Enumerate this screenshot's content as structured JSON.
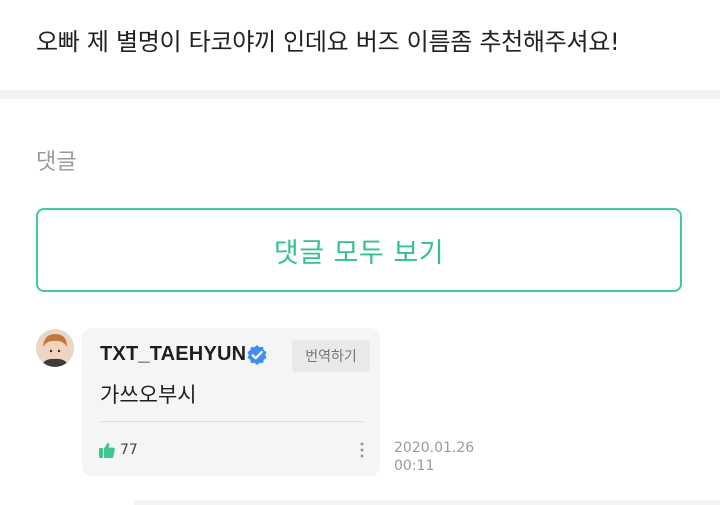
{
  "post": {
    "text": "오빠 제 별명이 타코야끼 인데요 버즈 이름좀 추천해주셔요!"
  },
  "comments": {
    "heading": "댓글",
    "view_all_label": "댓글 모두 보기",
    "items": [
      {
        "username": "TXT_TAEHYUN",
        "verified": true,
        "translate_label": "번역하기",
        "text": "가쓰오부시",
        "like_count": "77",
        "date": "2020.01.26",
        "time": "00:11"
      }
    ]
  },
  "colors": {
    "accent": "#35c08f",
    "verified_badge": "#3f8ef0",
    "like_icon": "#3fc58f"
  },
  "icons": {
    "verified": "verified-badge-icon",
    "like": "thumbs-up-icon",
    "more": "more-vertical-icon"
  }
}
